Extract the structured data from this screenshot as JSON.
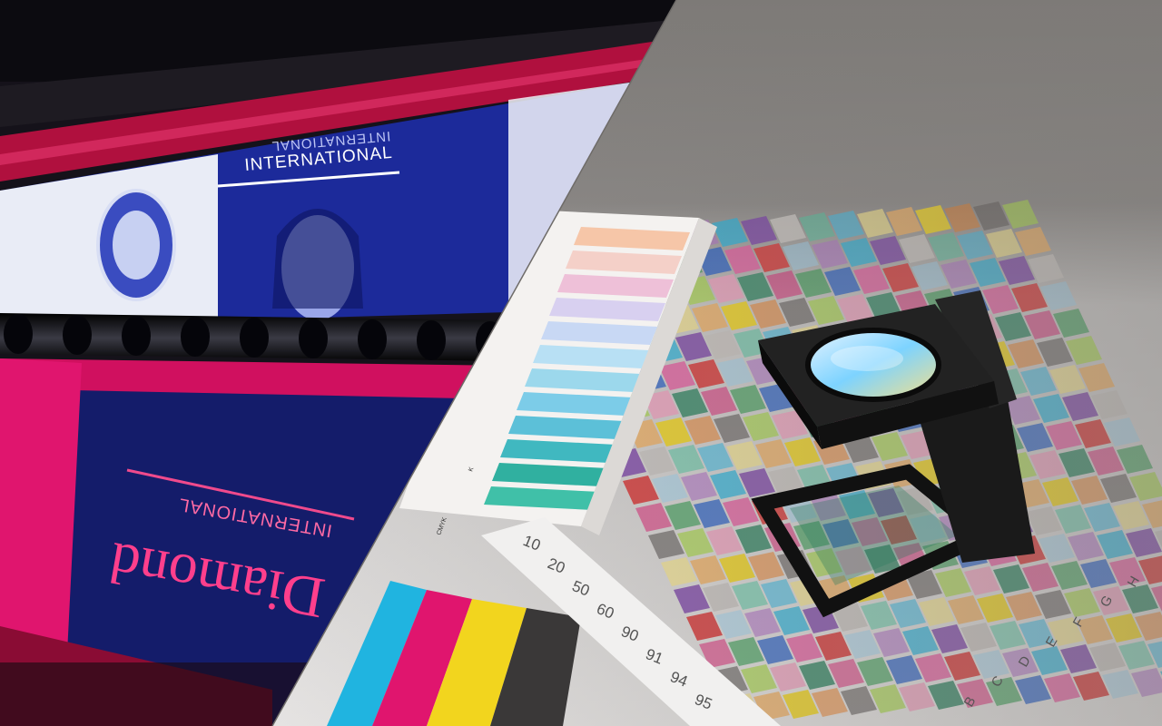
{
  "scene": {
    "left_panel": {
      "subject": "large-format printing press with printed posters on rollers",
      "printed_text_upper": "INTERNATIONAL",
      "printed_text_upper_mirrored": "INTERNATIONAL",
      "printed_text_lower_mirrored": "INTERNATIONAL",
      "printed_logo_mirrored": "Diamond"
    },
    "right_panel": {
      "subject": "color calibration chart with pantone swatch fan and linen tester loupe",
      "scale_numbers": [
        "10",
        "20",
        "50",
        "60",
        "90",
        "91",
        "94",
        "95"
      ],
      "column_letters": [
        "B",
        "C",
        "D",
        "E",
        "F",
        "G",
        "H"
      ],
      "swatch_fan_codes": [
        "CMYK",
        "K",
        "K",
        "K"
      ]
    },
    "colors": {
      "magenta": "#e0156e",
      "deep_blue": "#1c2a9a",
      "background_gray": "#7d7a77",
      "cyan": "#20b4e0",
      "yellow": "#f2d51e"
    }
  }
}
